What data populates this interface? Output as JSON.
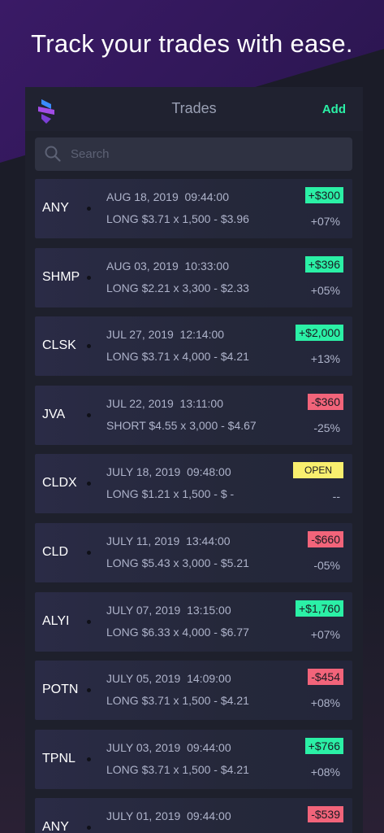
{
  "headline": "Track your trades with ease.",
  "appbar": {
    "title": "Trades",
    "add_label": "Add"
  },
  "search": {
    "placeholder": "Search"
  },
  "colors": {
    "accent": "#2bf0a6",
    "negative": "#f2647a",
    "open": "#f9ef6e"
  },
  "trades": [
    {
      "ticker": "ANY",
      "datetime": "AUG 18, 2019  09:44:00",
      "detail": "LONG $3.71 x 1,500 - $3.96",
      "pnl": "+$300",
      "pnl_type": "pos",
      "pct": "+07%"
    },
    {
      "ticker": "SHMP",
      "datetime": "AUG 03, 2019  10:33:00",
      "detail": "LONG $2.21 x 3,300 - $2.33",
      "pnl": "+$396",
      "pnl_type": "pos",
      "pct": "+05%"
    },
    {
      "ticker": "CLSK",
      "datetime": "JUL 27, 2019  12:14:00",
      "detail": "LONG $3.71 x 4,000 - $4.21",
      "pnl": "+$2,000",
      "pnl_type": "pos",
      "pct": "+13%"
    },
    {
      "ticker": "JVA",
      "datetime": "JUL 22, 2019  13:11:00",
      "detail": "SHORT $4.55 x 3,000 - $4.67",
      "pnl": "-$360",
      "pnl_type": "neg",
      "pct": "-25%"
    },
    {
      "ticker": "CLDX",
      "datetime": "JULY 18, 2019  09:48:00",
      "detail": "LONG $1.21 x 1,500 - $ -",
      "pnl": "OPEN",
      "pnl_type": "open",
      "pct": "--"
    },
    {
      "ticker": "CLD",
      "datetime": "JULY 11, 2019  13:44:00",
      "detail": "LONG $5.43 x 3,000 - $5.21",
      "pnl": "-$660",
      "pnl_type": "neg",
      "pct": "-05%"
    },
    {
      "ticker": "ALYI",
      "datetime": "JULY 07, 2019  13:15:00",
      "detail": "LONG $6.33 x 4,000 - $6.77",
      "pnl": "+$1,760",
      "pnl_type": "pos",
      "pct": "+07%"
    },
    {
      "ticker": "POTN",
      "datetime": "JULY 05, 2019  14:09:00",
      "detail": "LONG $3.71 x 1,500 - $4.21",
      "pnl": "-$454",
      "pnl_type": "neg",
      "pct": "+08%"
    },
    {
      "ticker": "TPNL",
      "datetime": "JULY 03, 2019  09:44:00",
      "detail": "LONG $3.71 x 1,500 - $4.21",
      "pnl": "+$766",
      "pnl_type": "pos",
      "pct": "+08%"
    },
    {
      "ticker": "ANY",
      "datetime": "JULY 01, 2019  09:44:00",
      "detail": "",
      "pnl": "-$539",
      "pnl_type": "neg",
      "pct": ""
    }
  ]
}
